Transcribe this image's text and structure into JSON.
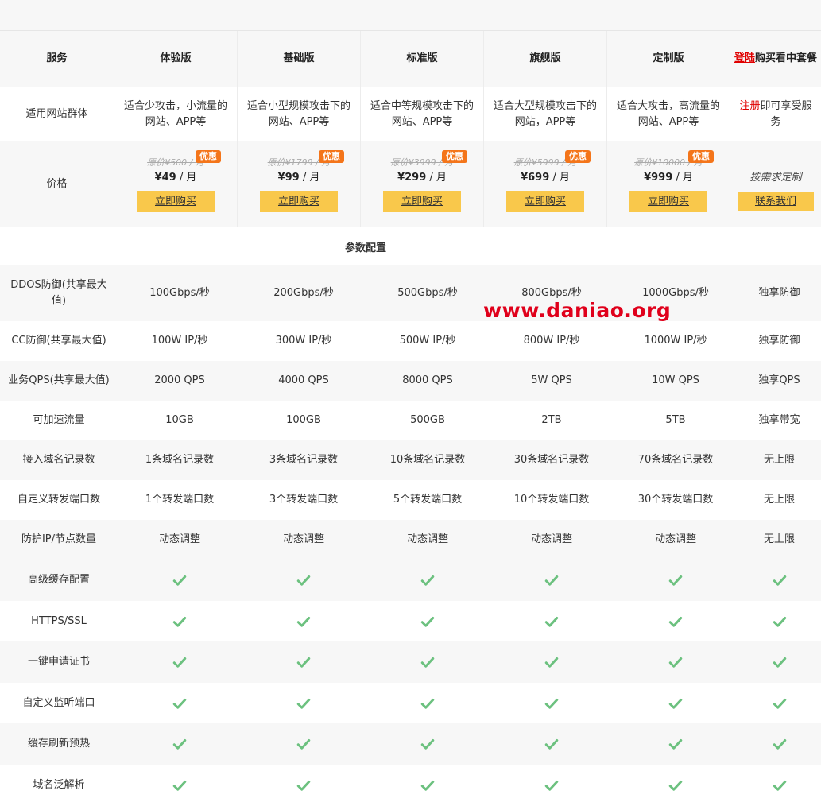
{
  "header": {
    "label": "服务",
    "plans": [
      "体验版",
      "基础版",
      "标准版",
      "旗舰版",
      "定制版"
    ],
    "last_link": "登陆",
    "last_rest": "购买看中套餐"
  },
  "audience": {
    "label": "适用网站群体",
    "values": [
      "适合少攻击，小流量的网站、APP等",
      "适合小型规模攻击下的网站、APP等",
      "适合中等规模攻击下的网站、APP等",
      "适合大型规模攻击下的网站，APP等",
      "适合大攻击，高流量的网站、APP等"
    ],
    "last_link": "注册",
    "last_rest": "即可享受服务"
  },
  "pricing": {
    "label": "价格",
    "badge": "优惠",
    "buy_label": "立即购买",
    "plans": [
      {
        "orig": "原价¥500 / 月",
        "price": "¥49",
        "unit": " / 月"
      },
      {
        "orig": "原价¥1799 / 月",
        "price": "¥99",
        "unit": " / 月"
      },
      {
        "orig": "原价¥3999 / 月",
        "price": "¥299",
        "unit": " / 月"
      },
      {
        "orig": "原价¥5999 / 月",
        "price": "¥699",
        "unit": " / 月"
      },
      {
        "orig": "原价¥10000 / 月",
        "price": "¥999",
        "unit": " / 月"
      }
    ],
    "custom": "按需求定制",
    "contact": "联系我们"
  },
  "section_title": "参数配置",
  "watermark": "www.daniao.org",
  "params": [
    {
      "label": "DDOS防御(共享最大值)",
      "values": [
        "100Gbps/秒",
        "200Gbps/秒",
        "500Gbps/秒",
        "800Gbps/秒",
        "1000Gbps/秒",
        "独享防御"
      ]
    },
    {
      "label": "CC防御(共享最大值)",
      "values": [
        "100W IP/秒",
        "300W IP/秒",
        "500W IP/秒",
        "800W IP/秒",
        "1000W IP/秒",
        "独享防御"
      ]
    },
    {
      "label": "业务QPS(共享最大值)",
      "values": [
        "2000 QPS",
        "4000 QPS",
        "8000 QPS",
        "5W QPS",
        "10W QPS",
        "独享QPS"
      ]
    },
    {
      "label": "可加速流量",
      "values": [
        "10GB",
        "100GB",
        "500GB",
        "2TB",
        "5TB",
        "独享带宽"
      ]
    },
    {
      "label": "接入域名记录数",
      "values": [
        "1条域名记录数",
        "3条域名记录数",
        "10条域名记录数",
        "30条域名记录数",
        "70条域名记录数",
        "无上限"
      ]
    },
    {
      "label": "自定义转发端口数",
      "values": [
        "1个转发端口数",
        "3个转发端口数",
        "5个转发端口数",
        "10个转发端口数",
        "30个转发端口数",
        "无上限"
      ]
    },
    {
      "label": "防护IP/节点数量",
      "values": [
        "动态调整",
        "动态调整",
        "动态调整",
        "动态调整",
        "动态调整",
        "无上限"
      ]
    }
  ],
  "features": [
    "高级缓存配置",
    "HTTPS/SSL",
    "一键申请证书",
    "自定义监听端口",
    "缓存刷新预热",
    "域名泛解析"
  ],
  "colors": {
    "accent": "#f9c84b",
    "badge": "#f4751a",
    "check": "#6cc17f",
    "link_red": "#e00000"
  }
}
